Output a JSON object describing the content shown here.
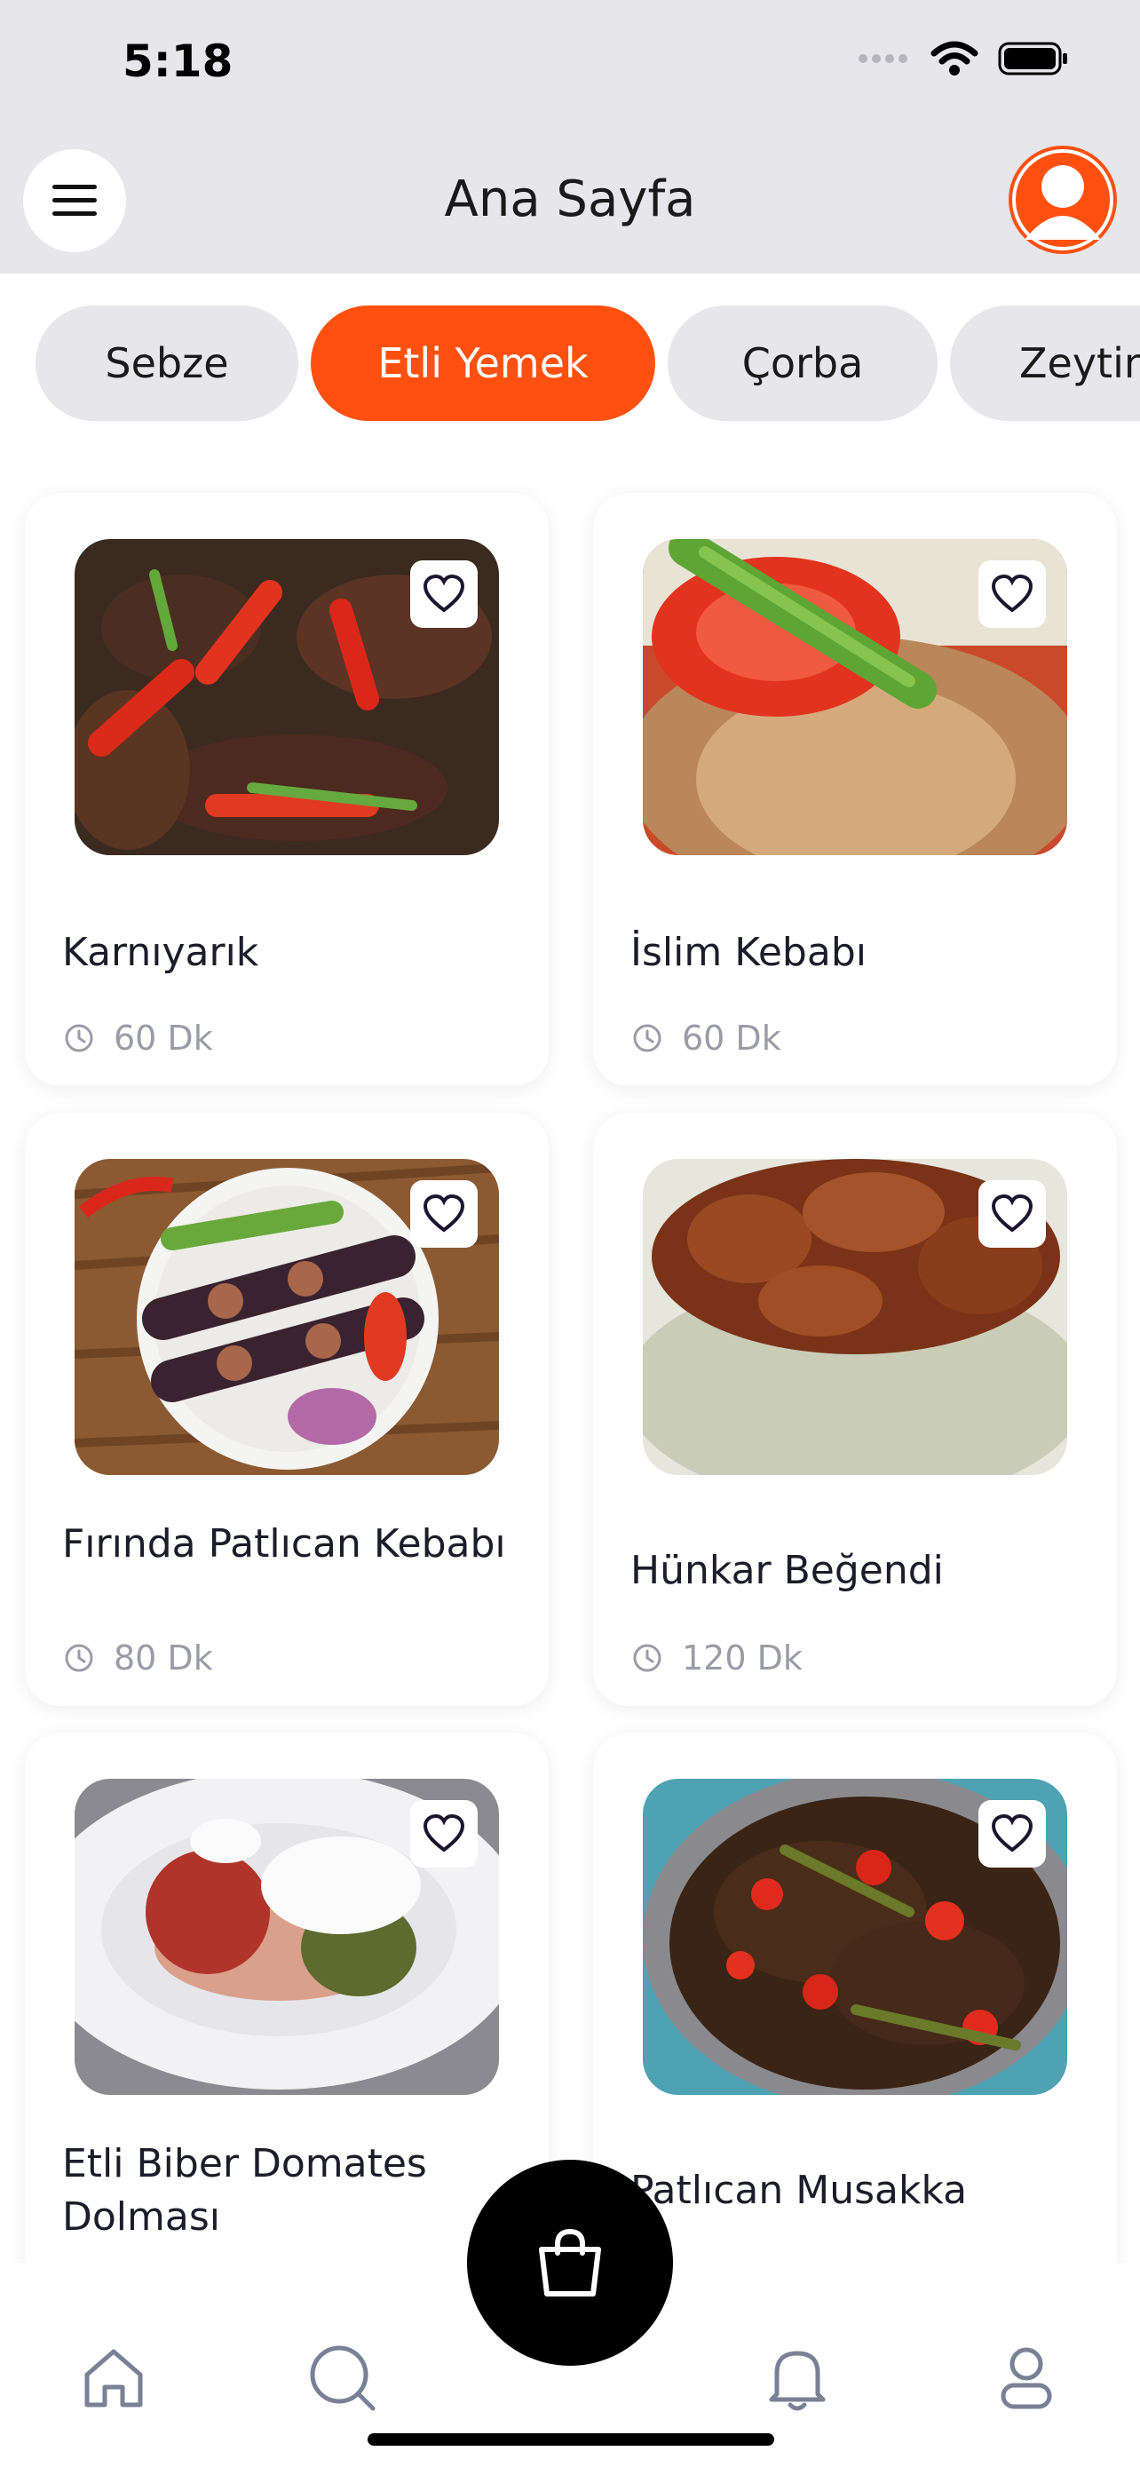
{
  "status": {
    "time": "5:18"
  },
  "header": {
    "title": "Ana Sayfa"
  },
  "icons": {
    "menu": "hamburger-menu-icon",
    "profile": "user-avatar-icon",
    "favorite": "heart-outline-icon",
    "time": "clock-icon",
    "cart": "shopping-bag-icon"
  },
  "colors": {
    "accent": "#ff5010",
    "chip": "#e6e6eb",
    "header_bg": "#e6e6eb"
  },
  "categories": [
    {
      "label": "Sebze",
      "active": false
    },
    {
      "label": "Etli Yemek",
      "active": true
    },
    {
      "label": "Çorba",
      "active": false
    },
    {
      "label": "Zeytin",
      "active": false
    }
  ],
  "recipes": [
    {
      "name": "Karnıyarık",
      "time": "60 Dk"
    },
    {
      "name": "İslim Kebabı",
      "time": "60 Dk"
    },
    {
      "name": "Fırında Patlıcan Kebabı",
      "time": "80 Dk"
    },
    {
      "name": "Hünkar Beğendi",
      "time": "120 Dk"
    },
    {
      "name": "Etli Biber Domates Dolması",
      "time": ""
    },
    {
      "name": "Patlıcan Musakka",
      "time": ""
    }
  ],
  "nav": {
    "items": [
      "home",
      "search",
      "notifications",
      "profile"
    ]
  }
}
